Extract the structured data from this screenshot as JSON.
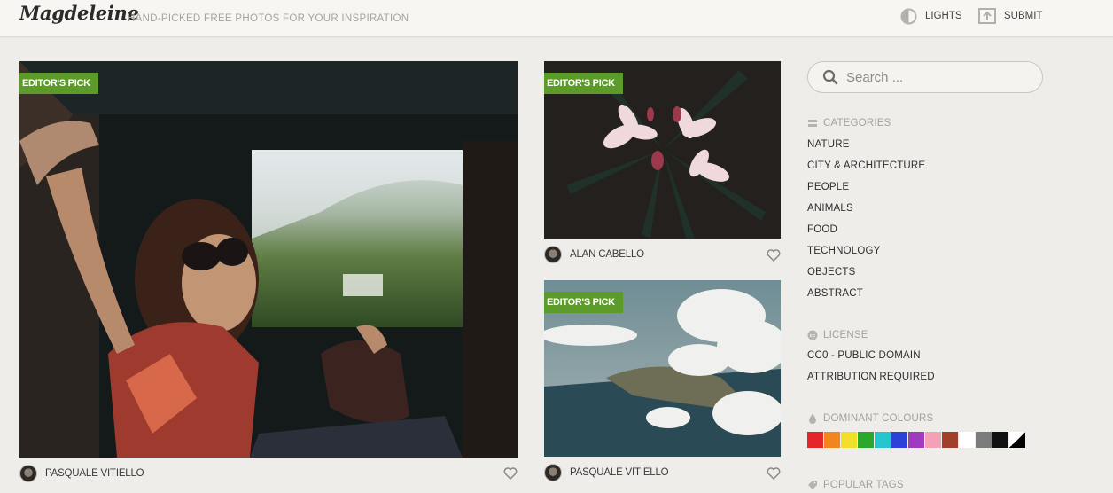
{
  "header": {
    "logo": "Magdeleine",
    "tagline": "HAND-PICKED FREE PHOTOS FOR YOUR INSPIRATION",
    "lights_label": "LIGHTS",
    "submit_label": "SUBMIT"
  },
  "photos": {
    "main": {
      "badge": "EDITOR'S PICK",
      "author": "PASQUALE VITIELLO"
    },
    "flower": {
      "badge": "EDITOR'S PICK",
      "author": "ALAN CABELLO"
    },
    "clouds": {
      "badge": "EDITOR'S PICK",
      "author": "PASQUALE VITIELLO"
    }
  },
  "sidebar": {
    "search": {
      "placeholder": "Search ..."
    },
    "categories": {
      "title": "CATEGORIES",
      "items": [
        "NATURE",
        "CITY & ARCHITECTURE",
        "PEOPLE",
        "ANIMALS",
        "FOOD",
        "TECHNOLOGY",
        "OBJECTS",
        "ABSTRACT"
      ]
    },
    "license": {
      "title": "LICENSE",
      "items": [
        "CC0 - PUBLIC DOMAIN",
        "ATTRIBUTION REQUIRED"
      ]
    },
    "colours": {
      "title": "DOMINANT COLOURS",
      "swatches": [
        "#e4262b",
        "#f0861c",
        "#f1e02a",
        "#2aa72d",
        "#26c4cd",
        "#2c41d8",
        "#a13bbd",
        "#f2a1b7",
        "#a1402a",
        "#ffffff",
        "#7b7b7b",
        "#111111",
        "black-white"
      ]
    },
    "tags": {
      "title": "POPULAR TAGS"
    }
  },
  "colors": {
    "accent": "#5c9a2a",
    "background": "#efedea"
  }
}
